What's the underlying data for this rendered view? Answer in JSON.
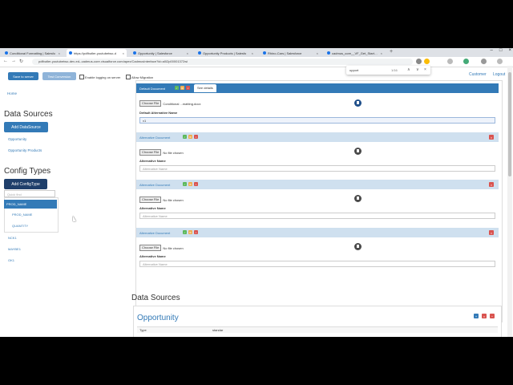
{
  "browser": {
    "tabs": [
      {
        "label": "Conditional Formatting | Salesfo"
      },
      {
        "label": "https://pdfbutler-youtubetwo-d"
      },
      {
        "label": "Opportunity | Salesforce"
      },
      {
        "label": "Opportunity Products | Salesfo"
      },
      {
        "label": "Rhino-Cars | Salesforce"
      },
      {
        "label": "cadmus_core__VF_Get_Started |"
      }
    ],
    "new_tab": "+",
    "window_controls": [
      "–",
      "□",
      "×"
    ],
    "url": "pdfbutler-youtubetwo-dev-ed--cadmus-core.visualforce.com/apex/CadmusInterface?id=a0l2p00001372wi",
    "nav": [
      "←",
      "→",
      "↻",
      "⌂"
    ]
  },
  "findbar": {
    "query": "upport",
    "count": "1/16",
    "up": "∧",
    "down": "∨",
    "close": "×"
  },
  "header": {
    "save_label": "Save to server",
    "test_label": "Test Conversion",
    "logging_label": "Enable logging on server",
    "migration_label": "Allow Migration",
    "customer_label": "Customer",
    "logout_label": "Logout"
  },
  "sidebar": {
    "home": "Home",
    "data_sources_heading": "Data Sources",
    "add_datasource": "Add DataSource",
    "datasources": [
      "Opportunity",
      "Opportunity Products"
    ],
    "config_types_heading": "Config Types",
    "add_configtype": "Add ConfigType",
    "quick_find_placeholder": "Quick find",
    "config_items": [
      "PROD_NAME",
      "PROD_NAME",
      "QUANTITY"
    ],
    "extra_items": [
      "NCK1",
      "MAYBE1",
      "OK1"
    ]
  },
  "documents": {
    "default": {
      "title": "Default Document",
      "see_details": "See details",
      "choose_file": "Choose File",
      "file_name": "Conditional ...matting.docx",
      "alt_name_label": "Default Alternative Name",
      "alt_name_value": "v1"
    },
    "alternatives": [
      {
        "title": "Alternative Document",
        "choose_file": "Choose File",
        "file_name": "No file chosen",
        "name_label": "Alternative Name",
        "name_placeholder": "Alternative Name"
      },
      {
        "title": "Alternative Document",
        "choose_file": "Choose File",
        "file_name": "No file chosen",
        "name_label": "Alternative Name",
        "name_placeholder": "Alternative Name"
      },
      {
        "title": "Alternative Document",
        "choose_file": "Choose File",
        "file_name": "No file chosen",
        "name_label": "Alternative Name",
        "name_placeholder": "Alternative Name"
      }
    ]
  },
  "data_sources_section": {
    "heading": "Data Sources",
    "opportunity_title": "Opportunity",
    "col_type": "Type",
    "col_value": "standar"
  },
  "colors": {
    "primary": "#337ab7",
    "danger": "#d9534f",
    "success": "#5cb85c",
    "warning": "#f0ad4e"
  }
}
